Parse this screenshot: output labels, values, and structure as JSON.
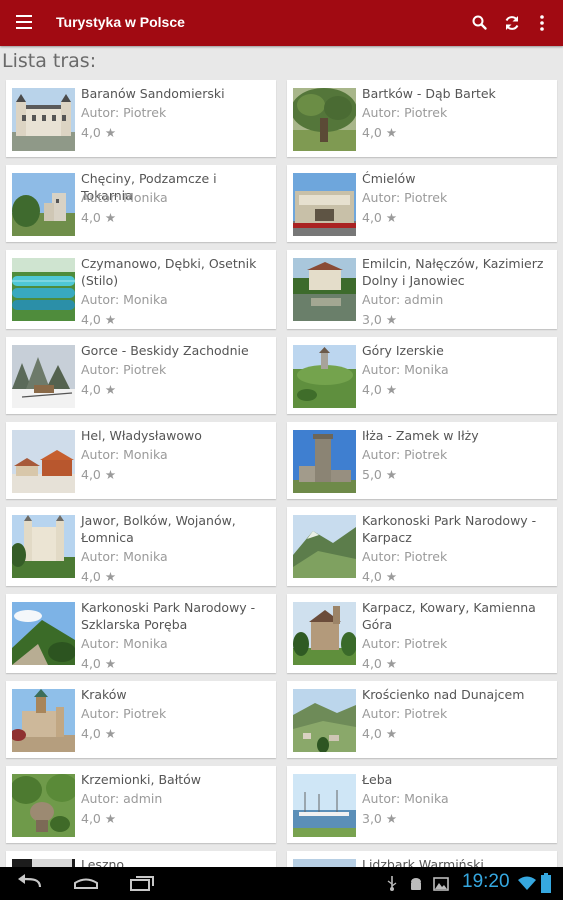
{
  "appbar": {
    "title": "Turystyka w Polsce",
    "background": "#a10a12",
    "icons": [
      "menu-icon",
      "search-icon",
      "refresh-icon",
      "overflow-menu-icon"
    ]
  },
  "heading": "Lista tras:",
  "rating_star": "★",
  "routes": [
    {
      "name": "Baranów Sandomierski",
      "author": "Autor: Piotrek",
      "rating": "4,0"
    },
    {
      "name": "Bartków - Dąb Bartek",
      "author": "Autor: Piotrek",
      "rating": "4,0"
    },
    {
      "name": "Chęciny, Podzamcze i Tokarnia",
      "author": "Autor: Monika",
      "rating": "4,0"
    },
    {
      "name": "Ćmielów",
      "author": "Autor: Piotrek",
      "rating": "4,0"
    },
    {
      "name": "Czymanowo, Dębki, Osetnik (Stilo)",
      "author": "Autor: Monika",
      "rating": "4,0"
    },
    {
      "name": "Emilcin, Nałęczów, Kazimierz Dolny i Janowiec",
      "author": "Autor: admin",
      "rating": "3,0"
    },
    {
      "name": "Gorce - Beskidy Zachodnie",
      "author": "Autor: Piotrek",
      "rating": "4,0"
    },
    {
      "name": "Góry Izerskie",
      "author": "Autor: Monika",
      "rating": "4,0"
    },
    {
      "name": "Hel, Władysławowo",
      "author": "Autor: Monika",
      "rating": "4,0"
    },
    {
      "name": "Iłża - Zamek w Iłży",
      "author": "Autor: Piotrek",
      "rating": "5,0"
    },
    {
      "name": "Jawor, Bolków, Wojanów, Łomnica",
      "author": "Autor: Monika",
      "rating": "4,0"
    },
    {
      "name": "Karkonoski Park Narodowy - Karpacz",
      "author": "Autor: Piotrek",
      "rating": "4,0"
    },
    {
      "name": "Karkonoski Park Narodowy - Szklarska Poręba",
      "author": "Autor: Monika",
      "rating": "4,0"
    },
    {
      "name": "Karpacz, Kowary, Kamienna Góra",
      "author": "Autor: Piotrek",
      "rating": "4,0"
    },
    {
      "name": "Kraków",
      "author": "Autor: Piotrek",
      "rating": "4,0"
    },
    {
      "name": "Krościenko nad Dunajcem",
      "author": "Autor: Piotrek",
      "rating": "4,0"
    },
    {
      "name": "Krzemionki, Bałtów",
      "author": "Autor: admin",
      "rating": "4,0"
    },
    {
      "name": "Łeba",
      "author": "Autor: Monika",
      "rating": "3,0"
    },
    {
      "name": "Leszno",
      "author": "",
      "rating": ""
    },
    {
      "name": "Lidzbark Warmiński",
      "author": "",
      "rating": ""
    }
  ],
  "statusbar": {
    "time": "19:20",
    "clock_color": "#36a8e0",
    "icons": [
      "back-icon",
      "home-icon",
      "recent-apps-icon",
      "usb-icon",
      "android-icon",
      "photo-icon",
      "wifi-icon",
      "battery-icon"
    ]
  }
}
